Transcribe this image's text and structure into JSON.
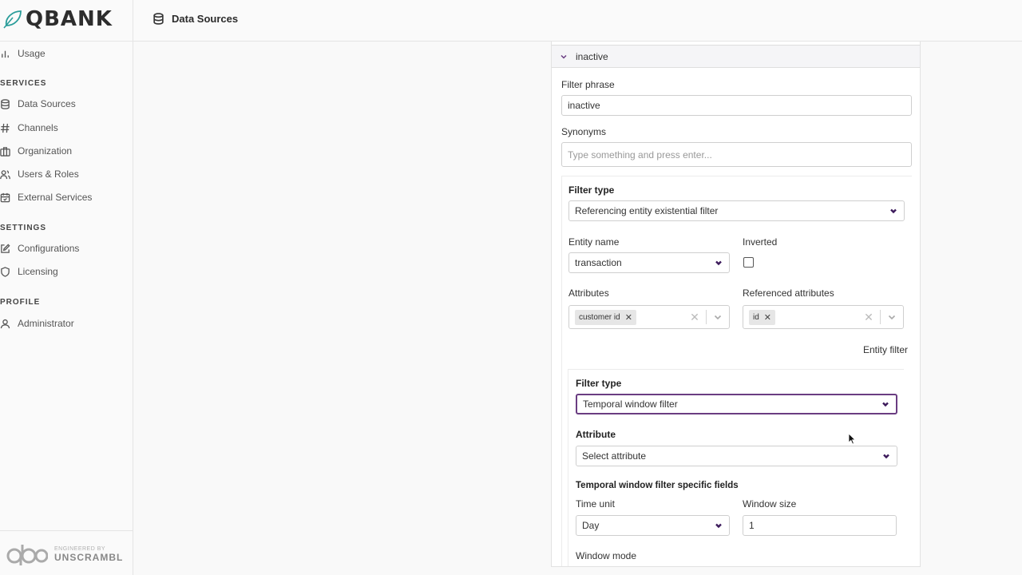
{
  "app": {
    "logo_text": "QBANK",
    "footer_engineered": "ENGINEERED BY",
    "footer_brand": "UNSCRAMBL"
  },
  "sidebar": {
    "top_items": [
      {
        "label": "Usage",
        "icon": "bar-chart-icon"
      }
    ],
    "sections": [
      {
        "title": "SERVICES",
        "items": [
          {
            "label": "Data Sources",
            "icon": "database-icon"
          },
          {
            "label": "Channels",
            "icon": "hash-icon"
          },
          {
            "label": "Organization",
            "icon": "briefcase-icon"
          },
          {
            "label": "Users & Roles",
            "icon": "users-icon"
          },
          {
            "label": "External Services",
            "icon": "calendar-icon"
          }
        ]
      },
      {
        "title": "SETTINGS",
        "items": [
          {
            "label": "Configurations",
            "icon": "edit-icon"
          },
          {
            "label": "Licensing",
            "icon": "shield-icon"
          }
        ]
      },
      {
        "title": "PROFILE",
        "items": [
          {
            "label": "Administrator",
            "icon": "user-icon"
          }
        ]
      }
    ]
  },
  "header": {
    "title": "Data Sources"
  },
  "panel": {
    "accordion_title": "inactive",
    "filter_phrase_label": "Filter phrase",
    "filter_phrase_value": "inactive",
    "synonyms_label": "Synonyms",
    "synonyms_placeholder": "Type something and press enter...",
    "filter_type_label": "Filter type",
    "filter_type_value": "Referencing entity existential filter",
    "entity_name_label": "Entity name",
    "entity_name_value": "transaction",
    "inverted_label": "Inverted",
    "inverted_checked": false,
    "attributes_label": "Attributes",
    "attributes_chips": [
      "customer id"
    ],
    "referenced_attributes_label": "Referenced attributes",
    "referenced_attributes_chips": [
      "id"
    ],
    "entity_filter_label": "Entity filter",
    "nested": {
      "filter_type_label": "Filter type",
      "filter_type_value": "Temporal window filter",
      "attribute_label": "Attribute",
      "attribute_value": "Select attribute",
      "specific_fields_label": "Temporal window filter specific fields",
      "time_unit_label": "Time unit",
      "time_unit_value": "Day",
      "window_size_label": "Window size",
      "window_size_value": "1",
      "window_mode_label": "Window mode"
    }
  },
  "colors": {
    "accent": "#6a3d82",
    "logo_teal": "#2a9d9a"
  }
}
